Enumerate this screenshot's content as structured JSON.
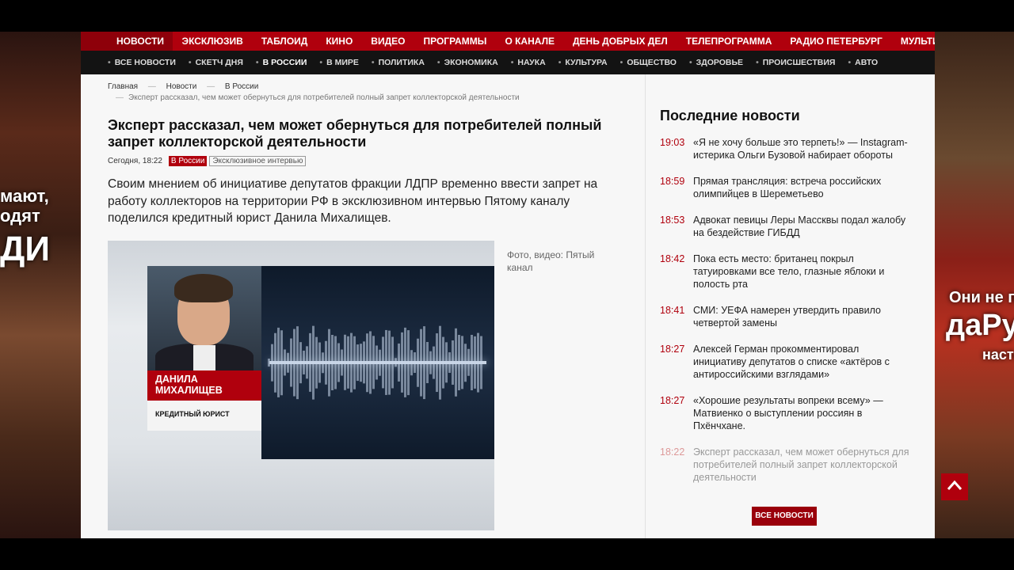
{
  "promo": {
    "left_line1": "мают,",
    "left_line2": "одят",
    "left_line3": "ДИ",
    "right_line1": "Они не п",
    "right_line2": "даРу",
    "right_line3": "насто"
  },
  "topnav": {
    "items": [
      "НОВОСТИ",
      "ЭКСКЛЮЗИВ",
      "ТАБЛОИД",
      "КИНО",
      "ВИДЕО",
      "ПРОГРАММЫ",
      "О КАНАЛЕ",
      "ДЕНЬ ДОБРЫХ ДЕЛ",
      "ТЕЛЕПРОГРАММА",
      "РАДИО ПЕТЕРБУРГ",
      "МУЛЬТИБЛОГ"
    ]
  },
  "subnav": {
    "items": [
      "ВСЕ НОВОСТИ",
      "СКЕТЧ ДНЯ",
      "В РОССИИ",
      "В МИРЕ",
      "ПОЛИТИКА",
      "ЭКОНОМИКА",
      "НАУКА",
      "КУЛЬТУРА",
      "ОБЩЕСТВО",
      "ЗДОРОВЬЕ",
      "ПРОИСШЕСТВИЯ",
      "АВТО"
    ]
  },
  "breadcrumb": {
    "home": "Главная",
    "news": "Новости",
    "section": "В России",
    "current": "Эксперт рассказал, чем может обернуться для потребителей полный запрет коллекторской деятельности"
  },
  "article": {
    "title": "Эксперт рассказал, чем может обернуться для потребителей полный запрет коллекторской деятельности",
    "date": "Сегодня, 18:22",
    "category_badge": "В России",
    "type_badge": "Эксклюзивное интервью",
    "lead": "Своим мнением об инициативе депутатов фракции ЛДПР временно ввести запрет на работу коллекторов на территории РФ в эксклюзивном интервью Пятому каналу поделился кредитный юрист Данила Михалищев.",
    "video_name_line1": "ДАНИЛА",
    "video_name_line2": "МИХАЛИЩЕВ",
    "video_role": "КРЕДИТНЫЙ ЮРИСТ",
    "caption": "Фото, видео: Пятый канал"
  },
  "sidebar": {
    "title": "Последние новости",
    "news": [
      {
        "time": "19:03",
        "text": "«Я не хочу больше это терпеть!» — Instagram-истерика Ольги Бузовой набирает обороты"
      },
      {
        "time": "18:59",
        "text": "Прямая трансляция: встреча российских олимпийцев в Шереметьево"
      },
      {
        "time": "18:53",
        "text": "Адвокат певицы Леры Массквы подал жалобу на бездействие ГИБДД"
      },
      {
        "time": "18:42",
        "text": "Пока есть место: британец покрыл татуировками все тело, глазные яблоки и полость рта"
      },
      {
        "time": "18:41",
        "text": "СМИ: УЕФА намерен утвердить правило четвертой замены"
      },
      {
        "time": "18:27",
        "text": "Алексей Герман прокомментировал инициативу депутатов о списке «актёров с антироссийскими взглядами»"
      },
      {
        "time": "18:27",
        "text": "«Хорошие результаты вопреки всему» — Матвиенко о выступлении россиян в Пхёнчхане."
      },
      {
        "time": "18:22",
        "text": "Эксперт рассказал, чем может обернуться для потребителей полный запрет коллекторской деятельности"
      }
    ],
    "all_news_label": "ВСЕ НОВОСТИ"
  },
  "colors": {
    "brand_red": "#b0000d",
    "subnav_bg": "#131313"
  }
}
